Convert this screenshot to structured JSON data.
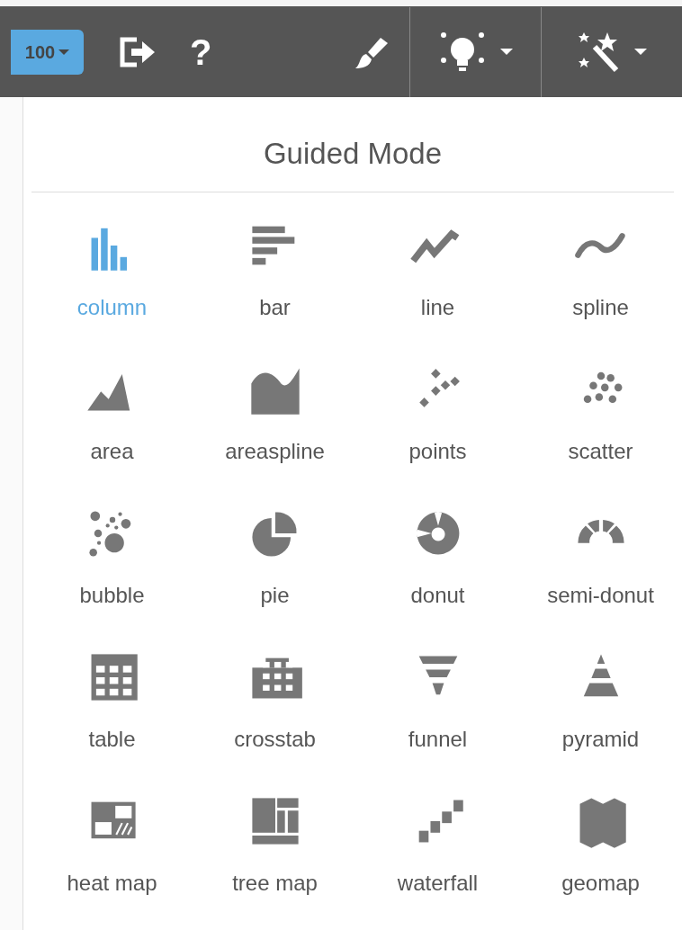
{
  "toolbar": {
    "zoom_button": {
      "label": "100"
    },
    "help_label": "?"
  },
  "panel": {
    "title": "Guided Mode"
  },
  "charts": [
    {
      "kind": "column",
      "label": "column",
      "selected": true
    },
    {
      "kind": "bar",
      "label": "bar",
      "selected": false
    },
    {
      "kind": "line",
      "label": "line",
      "selected": false
    },
    {
      "kind": "spline",
      "label": "spline",
      "selected": false
    },
    {
      "kind": "area",
      "label": "area",
      "selected": false
    },
    {
      "kind": "areaspline",
      "label": "areaspline",
      "selected": false
    },
    {
      "kind": "points",
      "label": "points",
      "selected": false
    },
    {
      "kind": "scatter",
      "label": "scatter",
      "selected": false
    },
    {
      "kind": "bubble",
      "label": "bubble",
      "selected": false
    },
    {
      "kind": "pie",
      "label": "pie",
      "selected": false
    },
    {
      "kind": "donut",
      "label": "donut",
      "selected": false
    },
    {
      "kind": "semidonut",
      "label": "semi-donut",
      "selected": false
    },
    {
      "kind": "table",
      "label": "table",
      "selected": false
    },
    {
      "kind": "crosstab",
      "label": "crosstab",
      "selected": false
    },
    {
      "kind": "funnel",
      "label": "funnel",
      "selected": false
    },
    {
      "kind": "pyramid",
      "label": "pyramid",
      "selected": false
    },
    {
      "kind": "heatmap",
      "label": "heat map",
      "selected": false
    },
    {
      "kind": "treemap",
      "label": "tree map",
      "selected": false
    },
    {
      "kind": "waterfall",
      "label": "waterfall",
      "selected": false
    },
    {
      "kind": "geomap",
      "label": "geomap",
      "selected": false
    }
  ]
}
